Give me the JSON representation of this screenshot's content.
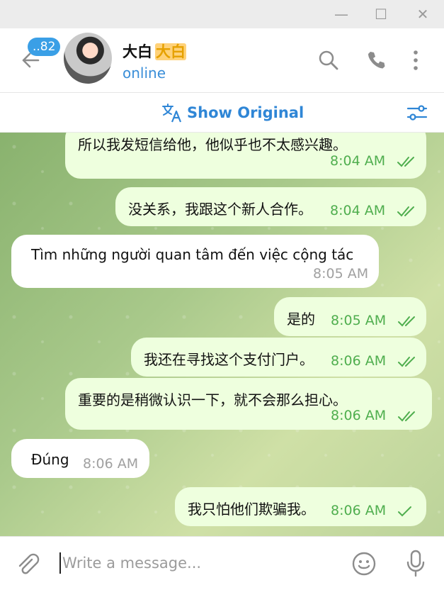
{
  "window": {
    "minimize_glyph": "—",
    "maximize_glyph": "☐",
    "close_glyph": "✕"
  },
  "header": {
    "unread_badge": "..82",
    "contact_name": "大白",
    "contact_name_emphasis": "大白",
    "status": "online"
  },
  "translate_bar": {
    "label": "Show Original"
  },
  "messages": [
    {
      "dir": "out",
      "text": "所以我发短信给他，他似乎也不太感兴趣。",
      "time": "8:04 AM",
      "read": true
    },
    {
      "dir": "out",
      "text": "没关系，我跟这个新人合作。",
      "time": "8:04 AM",
      "read": true
    },
    {
      "dir": "in",
      "text": "Tìm những người quan tâm đến việc cộng tác",
      "time": "8:05 AM"
    },
    {
      "dir": "out",
      "text": "是的",
      "time": "8:05 AM",
      "read": true
    },
    {
      "dir": "out",
      "text": "我还在寻找这个支付门户。",
      "time": "8:06 AM",
      "read": true
    },
    {
      "dir": "out",
      "text": "重要的是稍微认识一下，就不会那么担心。",
      "time": "8:06 AM",
      "read": true
    },
    {
      "dir": "in",
      "text": "Đúng",
      "time": "8:06 AM"
    },
    {
      "dir": "out",
      "text": "我只怕他们欺骗我。",
      "time": "8:06 AM",
      "read": false
    }
  ],
  "composer": {
    "placeholder": "Write a message..."
  },
  "colors": {
    "accent": "#3a8ed8",
    "outgoing_bubble": "#eeffde",
    "check": "#4fae4e"
  }
}
